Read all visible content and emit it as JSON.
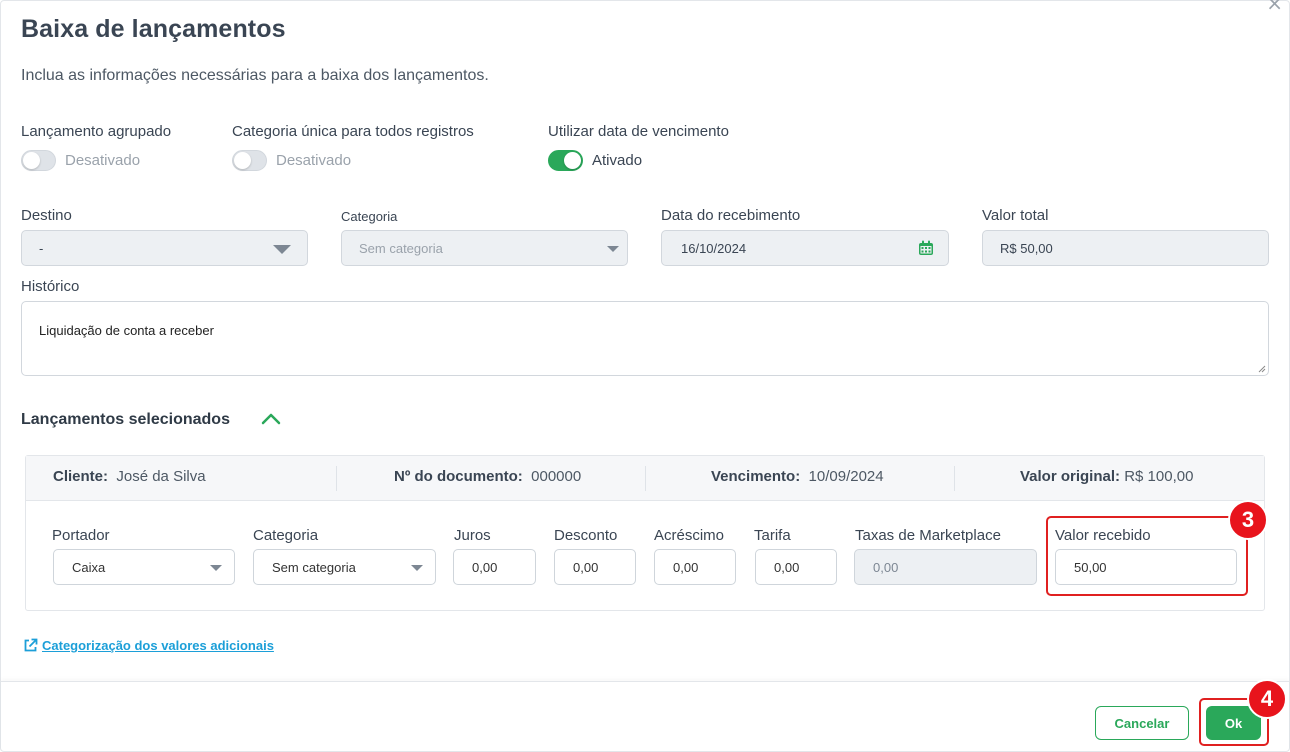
{
  "modal": {
    "title": "Baixa de lançamentos",
    "subtitle": "Inclua as informações necessárias para a baixa dos lançamentos.",
    "close_glyph": "×"
  },
  "toggles": [
    {
      "label": "Lançamento agrupado",
      "state": "Desativado",
      "on": false
    },
    {
      "label": "Categoria única para todos registros",
      "state": "Desativado",
      "on": false
    },
    {
      "label": "Utilizar data de vencimento",
      "state": "Ativado",
      "on": true
    }
  ],
  "form": {
    "destino_label": "Destino",
    "destino_value": "-",
    "categoria_label": "Categoria",
    "categoria_value": "Sem categoria",
    "data_label": "Data do recebimento",
    "data_value": "16/10/2024",
    "valor_total_label": "Valor total",
    "valor_total_value": "R$ 50,00",
    "historico_label": "Histórico",
    "historico_value": "Liquidação de conta a receber"
  },
  "section": {
    "title": "Lançamentos selecionados"
  },
  "entry": {
    "cliente_label": "Cliente:",
    "cliente_value": "José da Silva",
    "documento_label": "Nº do documento:",
    "documento_value": "000000",
    "vencimento_label": "Vencimento:",
    "vencimento_value": "10/09/2024",
    "valor_original_label": "Valor original:",
    "valor_original_value": "R$ 100,00",
    "portador_label": "Portador",
    "portador_value": "Caixa",
    "categoria_label": "Categoria",
    "categoria_value": "Sem categoria",
    "juros_label": "Juros",
    "juros_value": "0,00",
    "desconto_label": "Desconto",
    "desconto_value": "0,00",
    "acrescimo_label": "Acréscimo",
    "acrescimo_value": "0,00",
    "tarifa_label": "Tarifa",
    "tarifa_value": "0,00",
    "taxas_label": "Taxas de Marketplace",
    "taxas_value": "0,00",
    "valor_recebido_label": "Valor recebido",
    "valor_recebido_value": "50,00"
  },
  "link": {
    "text": "Categorização dos valores adicionais"
  },
  "footer": {
    "cancel_label": "Cancelar",
    "ok_label": "Ok"
  },
  "annotations": {
    "step_3": "3",
    "step_4": "4"
  },
  "colors": {
    "accent_green": "#2aa85a",
    "highlight_red": "#e02020",
    "link_blue": "#1c9fd8"
  }
}
